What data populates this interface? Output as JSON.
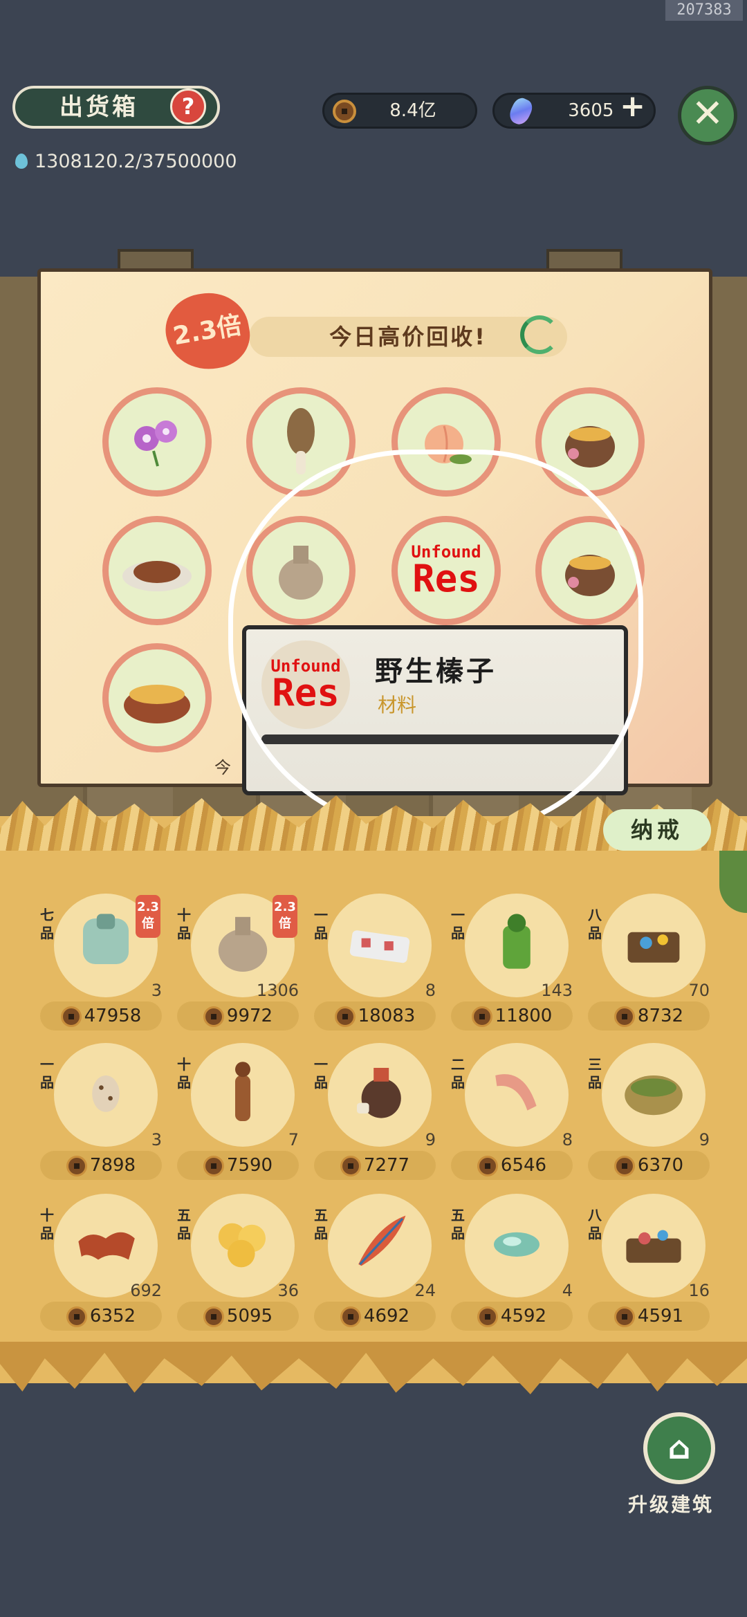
{
  "watermark": "207383",
  "header": {
    "title": "出货箱",
    "help_icon": "question-mark-icon",
    "coins": "8.4亿",
    "gems": "3605",
    "plus": "+",
    "close": "✕"
  },
  "water": {
    "value": "1308120.2/37500000"
  },
  "board": {
    "multiplier": "2.3倍",
    "banner": "今日高价回收!",
    "slot_unfound_1": "Unfound",
    "slot_unfound_2": "Res"
  },
  "tooltip": {
    "unfound_1": "Unfound",
    "unfound_2": "Res",
    "name": "野生榛子",
    "category": "材料",
    "cut_text": "今"
  },
  "storage": {
    "tag": "纳戒",
    "items": [
      {
        "grade": "七品",
        "count": "3",
        "price": "47958",
        "mult": "2.3倍",
        "icon": "armor-icon"
      },
      {
        "grade": "十品",
        "count": "1306",
        "price": "9972",
        "mult": "2.3倍",
        "icon": "clay-jar-icon"
      },
      {
        "grade": "一品",
        "count": "8",
        "price": "18083",
        "mult": "",
        "icon": "pastry-plate-icon"
      },
      {
        "grade": "一品",
        "count": "143",
        "price": "11800",
        "mult": "",
        "icon": "green-drink-icon"
      },
      {
        "grade": "八品",
        "count": "70",
        "price": "8732",
        "mult": "",
        "icon": "flower-tray-icon"
      },
      {
        "grade": "一品",
        "count": "3",
        "price": "7898",
        "mult": "",
        "icon": "quail-egg-icon"
      },
      {
        "grade": "十品",
        "count": "7",
        "price": "7590",
        "mult": "",
        "icon": "figurine-icon"
      },
      {
        "grade": "一品",
        "count": "9",
        "price": "7277",
        "mult": "",
        "icon": "wine-jar-icon"
      },
      {
        "grade": "二品",
        "count": "8",
        "price": "6546",
        "mult": "",
        "icon": "horn-icon"
      },
      {
        "grade": "三品",
        "count": "9",
        "price": "6370",
        "mult": "",
        "icon": "nest-basket-icon"
      },
      {
        "grade": "十品",
        "count": "692",
        "price": "6352",
        "mult": "",
        "icon": "cloth-icon"
      },
      {
        "grade": "五品",
        "count": "36",
        "price": "5095",
        "mult": "",
        "icon": "dough-buns-icon"
      },
      {
        "grade": "五品",
        "count": "24",
        "price": "4692",
        "mult": "",
        "icon": "feather-icon"
      },
      {
        "grade": "五品",
        "count": "4",
        "price": "4592",
        "mult": "",
        "icon": "jade-stone-icon"
      },
      {
        "grade": "八品",
        "count": "16",
        "price": "4591",
        "mult": "",
        "icon": "herb-tray-icon"
      }
    ]
  },
  "footer": {
    "upgrade_label": "升级建筑"
  },
  "colors": {
    "accent_red": "#e25b3f",
    "slot_ring": "#e7937a",
    "straw": "#e5b962",
    "board_green": "#2f4a3f"
  }
}
